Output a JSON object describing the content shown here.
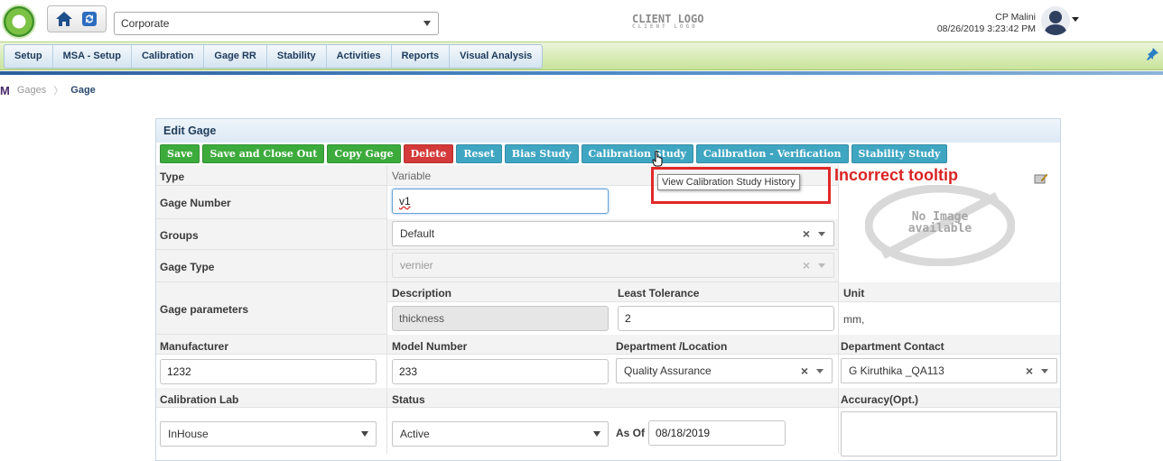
{
  "header": {
    "company_select": "Corporate",
    "client_logo": "CLIENT LOGO",
    "client_logo_sub": "CLIENT LOGO",
    "user_name": "CP Malini",
    "datetime": "08/26/2019 3:23:42 PM"
  },
  "nav": {
    "items": [
      {
        "label": "Setup"
      },
      {
        "label": "MSA - Setup"
      },
      {
        "label": "Calibration"
      },
      {
        "label": "Gage RR"
      },
      {
        "label": "Stability"
      },
      {
        "label": "Activities"
      },
      {
        "label": "Reports"
      },
      {
        "label": "Visual Analysis"
      }
    ]
  },
  "breadcrumb": {
    "root": "M",
    "items": [
      "Gages",
      "Gage"
    ]
  },
  "panel": {
    "title": "Edit Gage",
    "buttons": [
      {
        "label": "Save",
        "color": "#3cab3c"
      },
      {
        "label": "Save and Close Out",
        "color": "#3cab3c"
      },
      {
        "label": "Copy Gage",
        "color": "#3cab3c"
      },
      {
        "label": "Delete",
        "color": "#d43a3a"
      },
      {
        "label": "Reset",
        "color": "#3fa6c2"
      },
      {
        "label": "Bias Study",
        "color": "#3fa6c2"
      },
      {
        "label": "Calibration Study",
        "color": "#3fa6c2"
      },
      {
        "label": "Calibration - Verification",
        "color": "#3fa6c2"
      },
      {
        "label": "Stability Study",
        "color": "#3fa6c2"
      }
    ],
    "tooltip": "View Calibration Study History",
    "annotation": "Incorrect tooltip",
    "no_image": {
      "line1": "No Image",
      "line2": "available"
    },
    "fields": {
      "type_label": "Type",
      "type_value": "Variable",
      "gage_number_label": "Gage Number",
      "gage_number_value": "v1",
      "groups_label": "Groups",
      "groups_value": "Default",
      "gage_type_label": "Gage Type",
      "gage_type_value": "vernier",
      "gage_params_label": "Gage parameters",
      "description_label": "Description",
      "description_value": "thickness",
      "least_tolerance_label": "Least Tolerance",
      "least_tolerance_value": "2",
      "unit_label": "Unit",
      "unit_value": "mm,",
      "manufacturer_label": "Manufacturer",
      "manufacturer_value": "1232",
      "model_number_label": "Model Number",
      "model_number_value": "233",
      "department_label": "Department /Location",
      "department_value": "Quality Assurance",
      "dept_contact_label": "Department Contact",
      "dept_contact_value": "G Kiruthika _QA113",
      "calibration_lab_label": "Calibration Lab",
      "calibration_lab_value": "InHouse",
      "status_label": "Status",
      "status_value": "Active",
      "as_of_label": "As Of",
      "as_of_value": "08/18/2019",
      "accuracy_label": "Accuracy(Opt.)"
    }
  }
}
